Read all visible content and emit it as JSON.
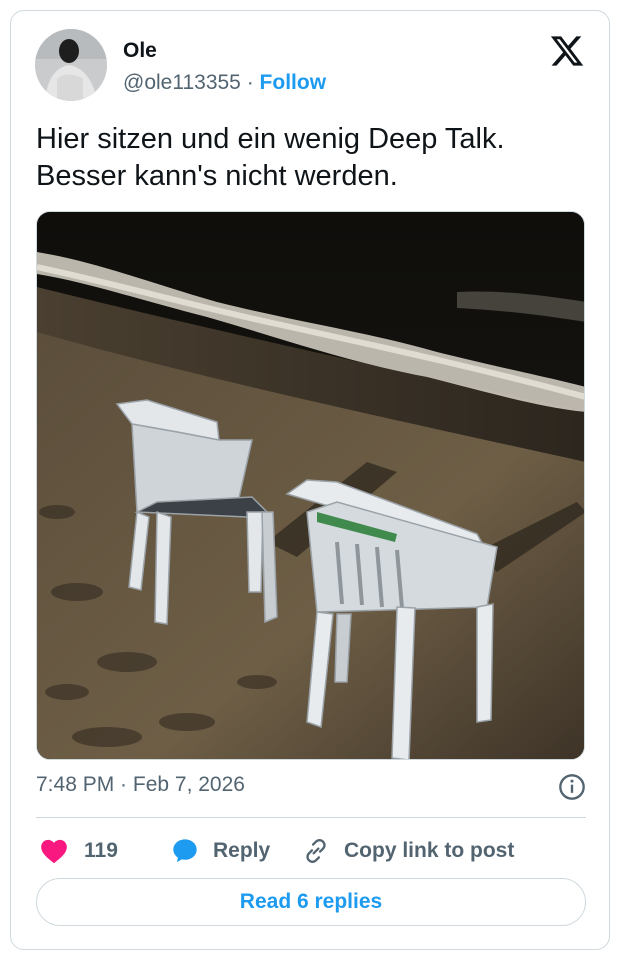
{
  "author": {
    "name": "Ole",
    "handle": "@ole113355",
    "separator": "·",
    "follow_label": "Follow"
  },
  "tweet": {
    "lines": [
      "Hier sitzen und ein wenig Deep Talk.",
      "Besser kann's nicht werden."
    ]
  },
  "media": {
    "icon": "photo-beach-chairs-at-night"
  },
  "meta": {
    "timestamp": "7:48 PM · Feb 7, 2026"
  },
  "actions": {
    "like_count": "119",
    "reply_label": "Reply",
    "copy_label": "Copy link to post"
  },
  "read_replies_label": "Read 6 replies",
  "colors": {
    "accent": "#1d9bf0",
    "like": "#f91880",
    "text": "#0f1419",
    "secondary": "#536471",
    "border": "#cfd9de"
  }
}
